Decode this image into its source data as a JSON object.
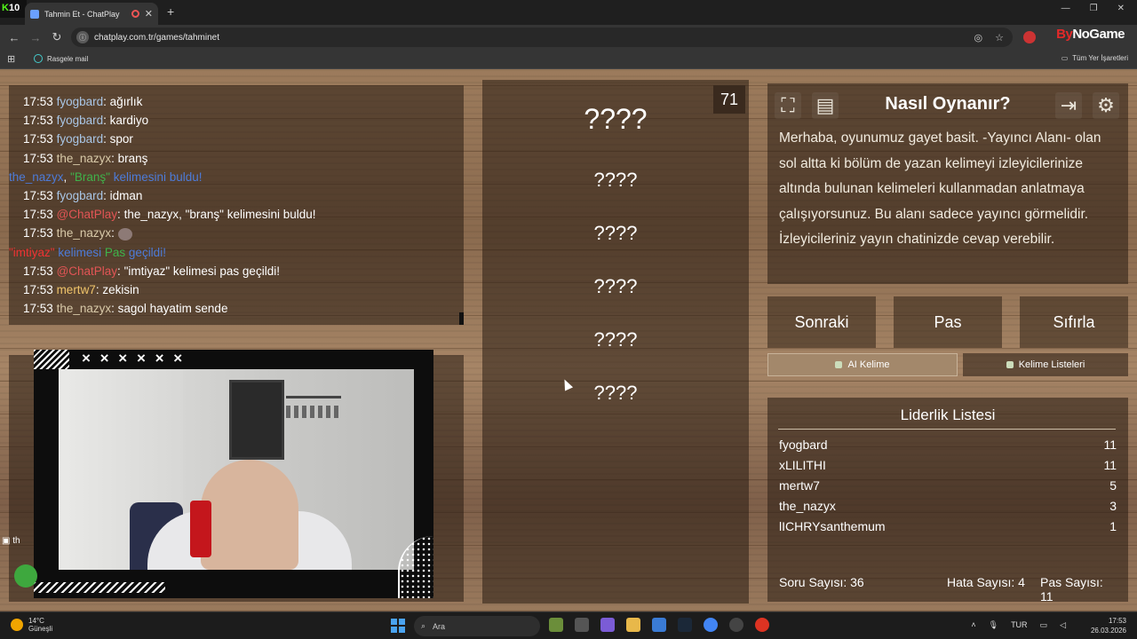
{
  "browser": {
    "kick_badge": "10",
    "tab_title": "Tahmin Et - ChatPlay",
    "url": "chatplay.com.tr/games/tahminet",
    "bookmark": "Rasgele mail",
    "all_bookmarks": "Tüm Yer İşaretleri",
    "brand_by": "By",
    "brand_rest": "NoGame"
  },
  "chat": [
    {
      "time": "17:53",
      "user": "fyogbard",
      "msg": "ağırlık",
      "cls": "u"
    },
    {
      "time": "17:53",
      "user": "fyogbard",
      "msg": "kardiyo",
      "cls": "u"
    },
    {
      "time": "17:53",
      "user": "fyogbard",
      "msg": "spor",
      "cls": "u"
    },
    {
      "time": "17:53",
      "user": "the_nazyx",
      "msg": "branş",
      "cls": "u nazyx"
    },
    {
      "time": "17:53",
      "user": "fyogbard",
      "msg": "idman",
      "cls": "u"
    },
    {
      "time": "17:53",
      "user": "@ChatPlay",
      "msg": "the_nazyx, \"branş\" kelimesini buldu!",
      "cls": "u cp"
    },
    {
      "time": "17:53",
      "user": "the_nazyx",
      "msg": "",
      "cls": "u nazyx"
    },
    {
      "time": "17:53",
      "user": "@ChatPlay",
      "msg": "\"imtiyaz\" kelimesi pas geçildi!",
      "cls": "u cp"
    },
    {
      "time": "17:53",
      "user": "mertw7",
      "msg": "zekisin",
      "cls": "u mert"
    },
    {
      "time": "17:53",
      "user": "the_nazyx",
      "msg": "sagol hayatim sende",
      "cls": "u nazyx"
    }
  ],
  "sys1": {
    "name": "the_nazyx",
    "word": "\"Branş\"",
    "rest": "kelimesini buldu!"
  },
  "sys2": {
    "word": "\"imtiyaz\"",
    "mid": "kelimesi",
    "pas": "Pas",
    "rest": "geçildi!"
  },
  "cam": {
    "x_marks": "× × × × × ×",
    "side": "th"
  },
  "game": {
    "timer": "71",
    "main_word": "????",
    "forbidden": [
      "????",
      "????",
      "????",
      "????",
      "????"
    ]
  },
  "howto": {
    "title": "Nasıl Oynanır?",
    "text": "Merhaba, oyunumuz gayet basit. -Yayıncı Alanı- olan sol altta ki bölüm de yazan kelimeyi izleyicilerinize altında bulunan kelimeleri kullanmadan anlatmaya çalışıyorsunuz. Bu alanı sadece yayıncı görmelidir. İzleyicileriniz yayın chatinizde cevap verebilir."
  },
  "buttons": {
    "next": "Sonraki",
    "pass": "Pas",
    "reset": "Sıfırla",
    "ai": "AI Kelime",
    "lists": "Kelime Listeleri"
  },
  "leaderboard": {
    "title": "Liderlik Listesi",
    "rows": [
      {
        "name": "fyogbard",
        "score": "11"
      },
      {
        "name": "xLILITHI",
        "score": "11"
      },
      {
        "name": "mertw7",
        "score": "5"
      },
      {
        "name": "the_nazyx",
        "score": "3"
      },
      {
        "name": "lICHRYsanthemum",
        "score": "1"
      }
    ],
    "questions": "Soru Sayısı: 36",
    "errors": "Hata Sayısı: 4",
    "passes": "Pas Sayısı: 11"
  },
  "taskbar": {
    "temp": "14°C",
    "weather": "Güneşli",
    "search": "Ara",
    "lang": "TUR",
    "time": "17:53",
    "date": "26.03.2026"
  }
}
